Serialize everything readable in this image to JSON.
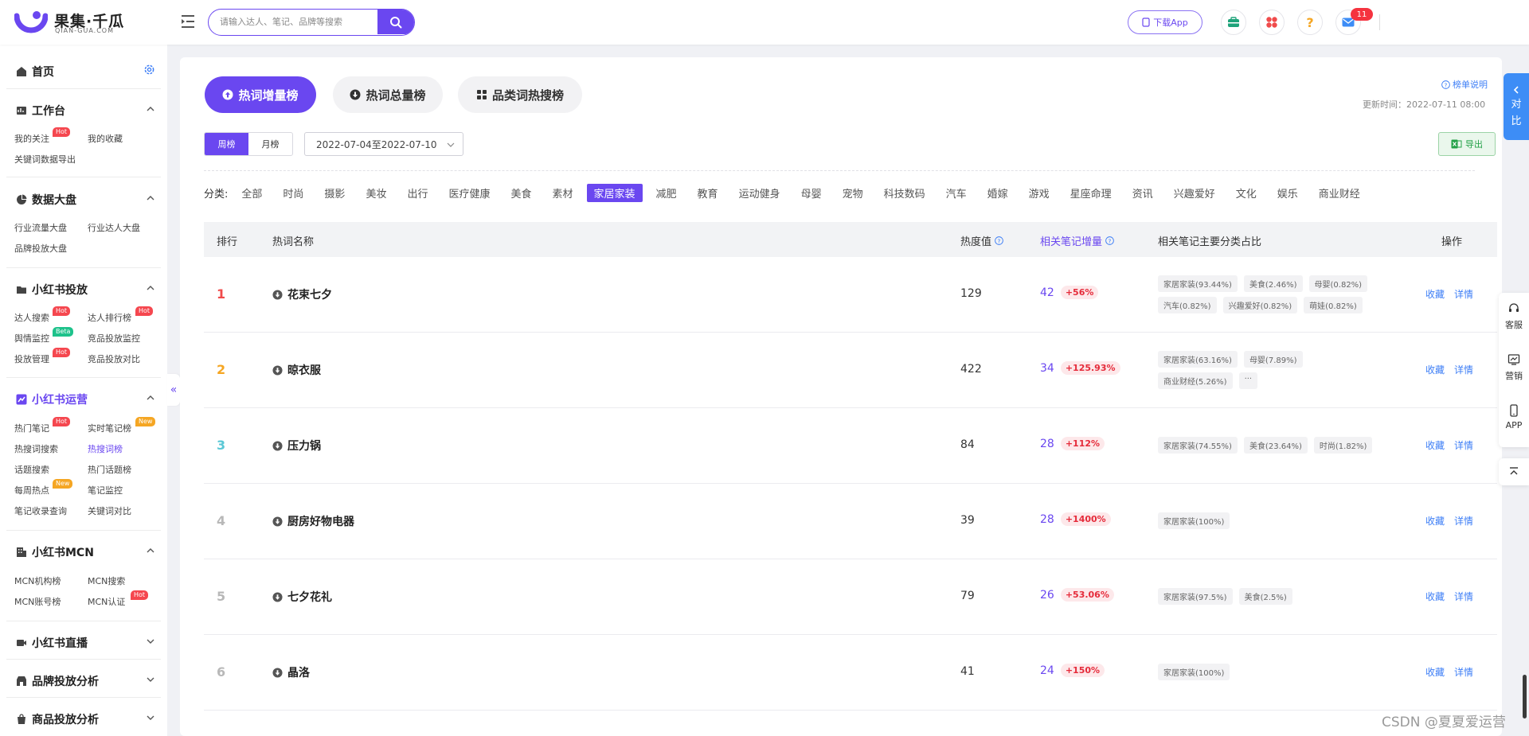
{
  "header": {
    "logo_cn": "果集·千瓜",
    "logo_en": "QIAN-GUA.COM",
    "search_placeholder": "请输入达人、笔记、品牌等搜索",
    "download_app": "下载App",
    "message_count": "11"
  },
  "sidebar": {
    "home": "首页",
    "sections": [
      {
        "title": "工作台",
        "items": [
          "我的关注",
          "我的收藏",
          "关键词数据导出"
        ]
      },
      {
        "title": "数据大盘",
        "items": [
          "行业流量大盘",
          "行业达人大盘",
          "品牌投放大盘"
        ]
      },
      {
        "title": "小红书投放",
        "items": [
          "达人搜索",
          "达人排行榜",
          "舆情监控",
          "竞品投放监控",
          "投放管理",
          "竞品投放对比"
        ]
      },
      {
        "title": "小红书运营",
        "items": [
          "热门笔记",
          "实时笔记榜",
          "热搜词搜索",
          "热搜词榜",
          "话题搜索",
          "热门话题榜",
          "每周热点",
          "笔记监控",
          "笔记收录查询",
          "关键词对比"
        ]
      },
      {
        "title": "小红书MCN",
        "items": [
          "MCN机构榜",
          "MCN搜索",
          "MCN账号榜",
          "MCN认证"
        ]
      },
      {
        "title": "小红书直播"
      },
      {
        "title": "品牌投放分析"
      },
      {
        "title": "商品投放分析"
      }
    ],
    "tags": {
      "hot": "Hot",
      "new": "New",
      "beta": "Beta"
    }
  },
  "main": {
    "tabs": [
      "热词增量榜",
      "热词总量榜",
      "品类词热搜榜"
    ],
    "help": "榜单说明",
    "update_time": "更新时间：2022-07-11 08:00",
    "period": [
      "周榜",
      "月榜"
    ],
    "date_range": "2022-07-04至2022-07-10",
    "export": "导出",
    "category_label": "分类:",
    "categories": [
      "全部",
      "时尚",
      "摄影",
      "美妆",
      "出行",
      "医疗健康",
      "美食",
      "素材",
      "家居家装",
      "减肥",
      "教育",
      "运动健身",
      "母婴",
      "宠物",
      "科技数码",
      "汽车",
      "婚嫁",
      "游戏",
      "星座命理",
      "资讯",
      "兴趣爱好",
      "文化",
      "娱乐",
      "商业财经"
    ],
    "selected_category": "家居家装",
    "table_headers": {
      "rank": "排行",
      "name": "热词名称",
      "heat": "热度值",
      "increase": "相关笔记增量",
      "distribution": "相关笔记主要分类占比",
      "ops": "操作"
    },
    "rows": [
      {
        "rank": "1",
        "name": "花束七夕",
        "heat": "129",
        "increase": "42",
        "pct": "+56%",
        "dist": [
          "家居家装(93.44%)",
          "美食(2.46%)",
          "母婴(0.82%)",
          "汽车(0.82%)",
          "兴趣爱好(0.82%)",
          "萌娃(0.82%)"
        ]
      },
      {
        "rank": "2",
        "name": "晾衣服",
        "heat": "422",
        "increase": "34",
        "pct": "+125.93%",
        "dist": [
          "家居家装(63.16%)",
          "母婴(7.89%)",
          "商业财经(5.26%)",
          "···"
        ]
      },
      {
        "rank": "3",
        "name": "压力锅",
        "heat": "84",
        "increase": "28",
        "pct": "+112%",
        "dist": [
          "家居家装(74.55%)",
          "美食(23.64%)",
          "时尚(1.82%)"
        ]
      },
      {
        "rank": "4",
        "name": "厨房好物电器",
        "heat": "39",
        "increase": "28",
        "pct": "+1400%",
        "dist": [
          "家居家装(100%)"
        ]
      },
      {
        "rank": "5",
        "name": "七夕花礼",
        "heat": "79",
        "increase": "26",
        "pct": "+53.06%",
        "dist": [
          "家居家装(97.5%)",
          "美食(2.5%)"
        ]
      },
      {
        "rank": "6",
        "name": "晶洛",
        "heat": "41",
        "increase": "24",
        "pct": "+150%",
        "dist": [
          "家居家装(100%)"
        ]
      }
    ],
    "op_collect": "收藏",
    "op_detail": "详情"
  },
  "right_float": {
    "compare": [
      "对",
      "比"
    ],
    "service": "客服",
    "marketing": "营销",
    "app": "APP"
  },
  "watermark": "CSDN @夏夏爱运营",
  "colors": {
    "accent": "#6a47f0",
    "link": "#3d7ef6",
    "rank1": "#f04b4b",
    "rank2": "#f5a623",
    "rank3": "#5bc8d6",
    "rank_other": "#b8b8b8"
  }
}
